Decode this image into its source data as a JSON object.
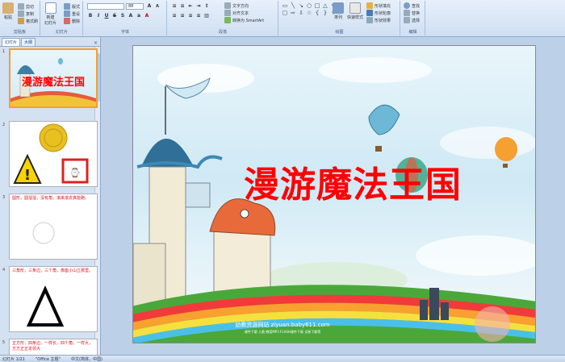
{
  "ribbon": {
    "clipboard": {
      "label": "剪贴板",
      "paste": "粘贴",
      "cut": "剪切",
      "copy": "复制",
      "format_painter": "格式刷"
    },
    "slides": {
      "label": "幻灯片",
      "new_slide": "新建\n幻灯片",
      "layout": "版式",
      "reset": "重设",
      "delete": "删除"
    },
    "font": {
      "label": "字体",
      "font_size": "88"
    },
    "paragraph": {
      "label": "段落",
      "text_direction": "文字方向",
      "align_text": "对齐文本",
      "smartart": "转换为 SmartArt"
    },
    "drawing": {
      "label": "绘图",
      "arrange": "排列",
      "quick_styles": "快速样式",
      "shape_fill": "形状填充",
      "shape_outline": "形状轮廓",
      "shape_effects": "形状效果"
    },
    "editing": {
      "label": "编辑",
      "find": "查找",
      "replace": "替换",
      "select": "选择"
    }
  },
  "panel": {
    "tabs": [
      "幻灯片",
      "大纲"
    ],
    "close": "×",
    "slides": [
      {
        "num": "1",
        "title": "漫游魔法王国"
      },
      {
        "num": "2"
      },
      {
        "num": "3",
        "text": "圆形，圆溜溜，没有角，滚来滚去真能跑。"
      },
      {
        "num": "4",
        "text": "三角形，三条边，三个角，像座小山立那里。"
      },
      {
        "num": "5",
        "text": "正方形，四条边，一样长，四个角，一样大，方方正正本领大"
      }
    ]
  },
  "slide": {
    "title": "漫游魔法王国",
    "footer_site": "幼教资源网站  ziyuan.baby611.com",
    "footer_sub": "课件下载  儿歌  教案MP3  FLASH课件下载  试卷下载等"
  },
  "status": {
    "slide_info": "幻灯片 1/21",
    "theme": "\"Office 主题\"",
    "language": "中文(简体，中国)"
  }
}
